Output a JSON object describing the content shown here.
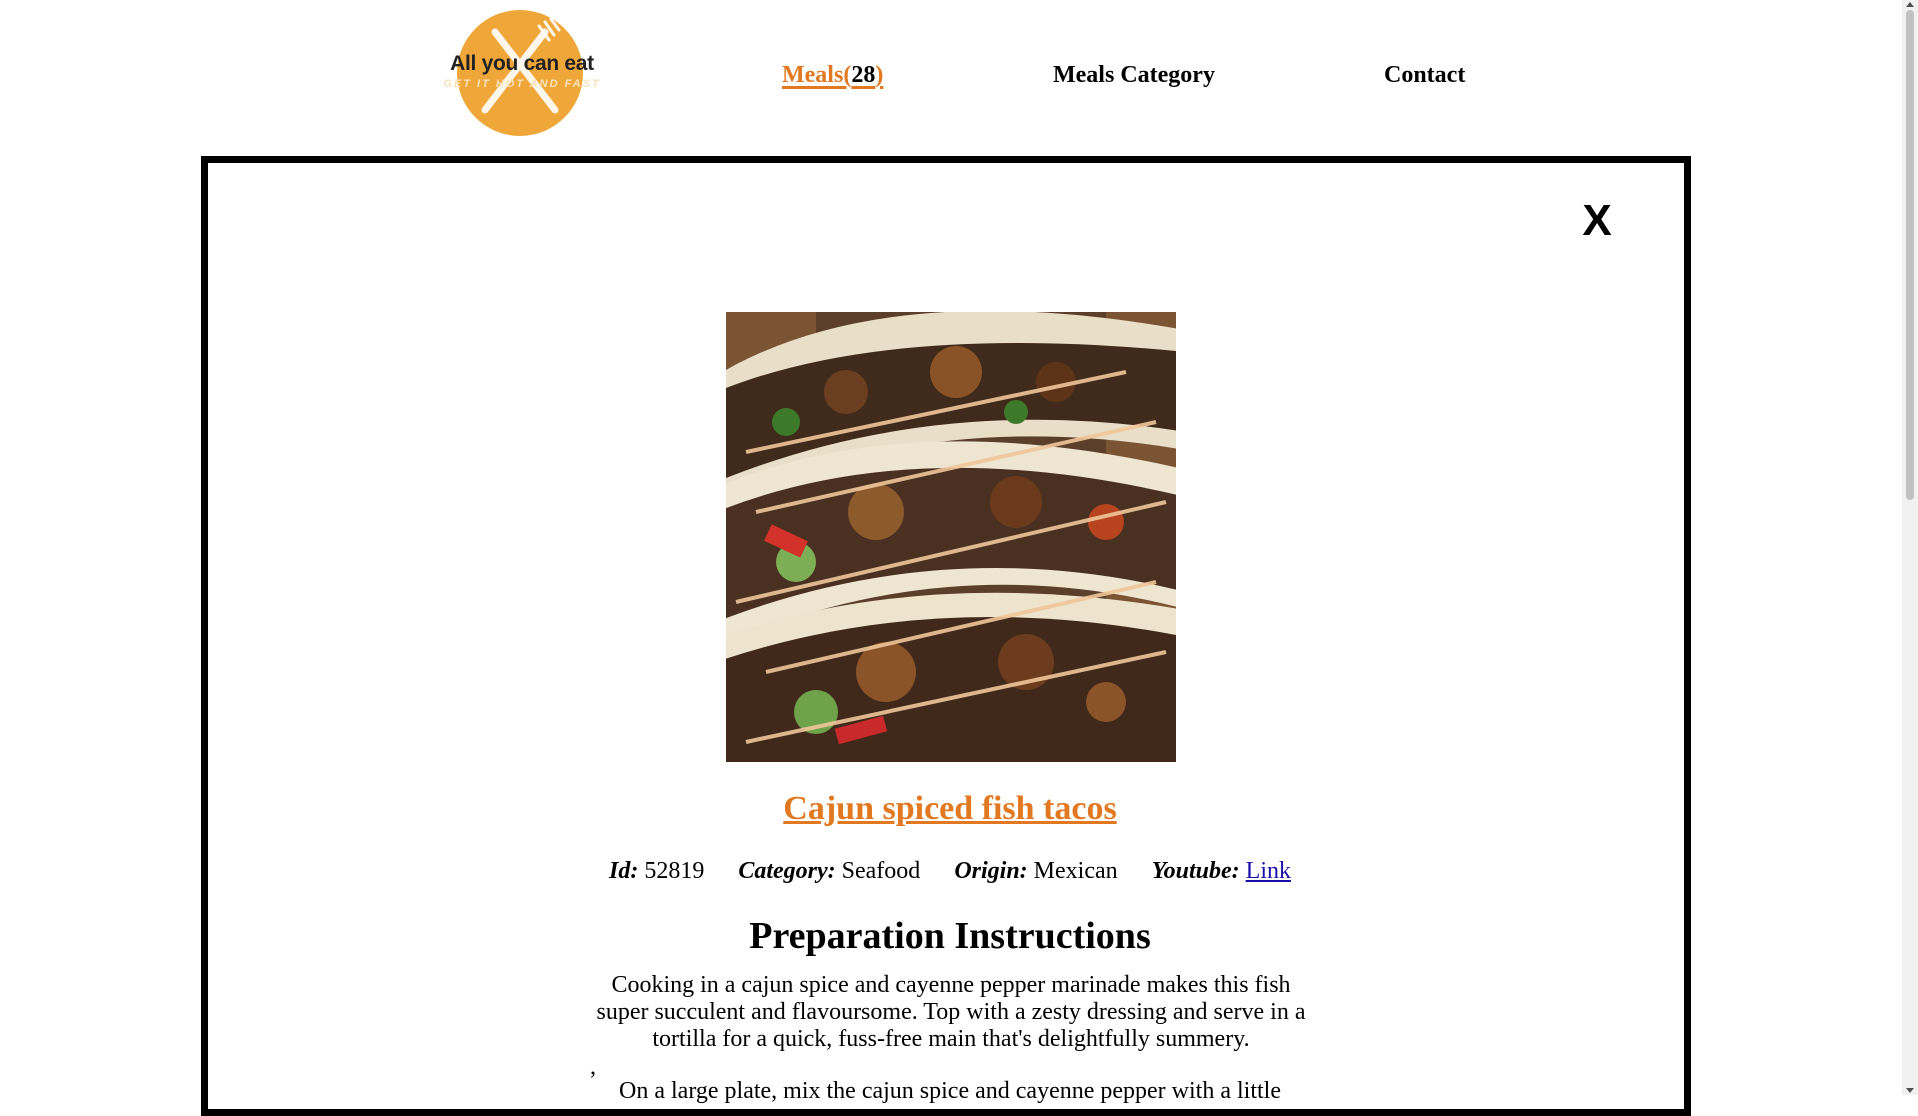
{
  "logo": {
    "brand": "All you can eat",
    "tagline": "GET IT HOT AND FAST",
    "accent_color": "#f0a73a"
  },
  "nav": {
    "meals_label": "Meals(",
    "meals_count": "28",
    "meals_close": ")",
    "category_label": "Meals Category",
    "contact_label": "Contact",
    "active_color": "#e2781f"
  },
  "modal": {
    "close_label": "X",
    "meal": {
      "title": "Cajun spiced fish tacos",
      "id_label": "Id:",
      "id": "52819",
      "category_label": "Category:",
      "category": "Seafood",
      "origin_label": "Origin:",
      "origin": "Mexican",
      "youtube_label": "Youtube:",
      "youtube_link_text": "Link"
    },
    "prep_heading": "Preparation Instructions",
    "description": "Cooking in a cajun spice and cayenne pepper marinade makes this fish super succulent and flavoursome. Top with a zesty dressing and serve in a tortilla for a quick, fuss-free main that's delightfully summery.",
    "separator": ",",
    "step1": "On a large plate, mix the cajun spice and cayenne pepper with a little"
  }
}
